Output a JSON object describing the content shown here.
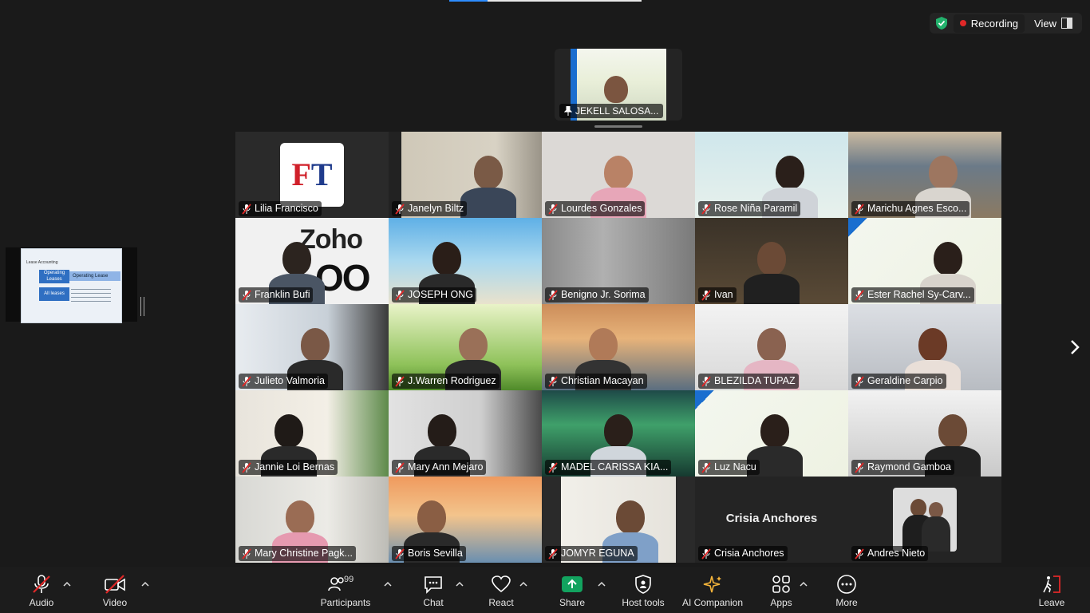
{
  "top_right": {
    "recording_label": "Recording",
    "view_label": "View"
  },
  "active_speaker": {
    "name": "JEKELL SALOSA..."
  },
  "participants": [
    {
      "name": "Lilia Francisco"
    },
    {
      "name": "Janelyn Biltz"
    },
    {
      "name": "Lourdes Gonzales"
    },
    {
      "name": "Rose Niña Paramil"
    },
    {
      "name": "Marichu Agnes Esco..."
    },
    {
      "name": "Franklin Bufi"
    },
    {
      "name": "JOSEPH ONG"
    },
    {
      "name": "Benigno Jr. Sorima"
    },
    {
      "name": "Ivan"
    },
    {
      "name": "Ester Rachel Sy-Carv..."
    },
    {
      "name": "Julieto Valmoria"
    },
    {
      "name": "J.Warren Rodriguez"
    },
    {
      "name": "Christian Macayan"
    },
    {
      "name": "BLEZILDA TUPAZ"
    },
    {
      "name": "Geraldine Carpio"
    },
    {
      "name": "Jannie Loi Bernas"
    },
    {
      "name": "Mary Ann Mejaro"
    },
    {
      "name": "MADEL CARISSA KIA..."
    },
    {
      "name": "Luz Nacu"
    },
    {
      "name": "Raymond Gamboa"
    },
    {
      "name": "Mary Christine Pagk..."
    },
    {
      "name": "Boris Sevilla"
    },
    {
      "name": "JOMYR EGUNA"
    },
    {
      "name": "Crisia Anchores",
      "display_name": "Crisia Anchores"
    },
    {
      "name": "Andres Nieto"
    }
  ],
  "logos": {
    "ft_f": "F",
    "ft_t": "T",
    "zoho_line1": "Zoho",
    "zoho_line2": "OO"
  },
  "shared_slide": {
    "title": "Lease Accounting",
    "box1": "Operating Leases",
    "arrow": "Operating Lease",
    "box2": "All leases"
  },
  "toolbar": {
    "audio": "Audio",
    "video": "Video",
    "participants": "Participants",
    "participants_count": "99",
    "chat": "Chat",
    "react": "React",
    "share": "Share",
    "host_tools": "Host tools",
    "ai_companion": "AI Companion",
    "apps": "Apps",
    "more": "More",
    "leave": "Leave"
  },
  "colors": {
    "share_green": "#12a35f",
    "recording_red": "#e02828",
    "mute_red": "#e02828",
    "leave_red": "#e02828"
  }
}
